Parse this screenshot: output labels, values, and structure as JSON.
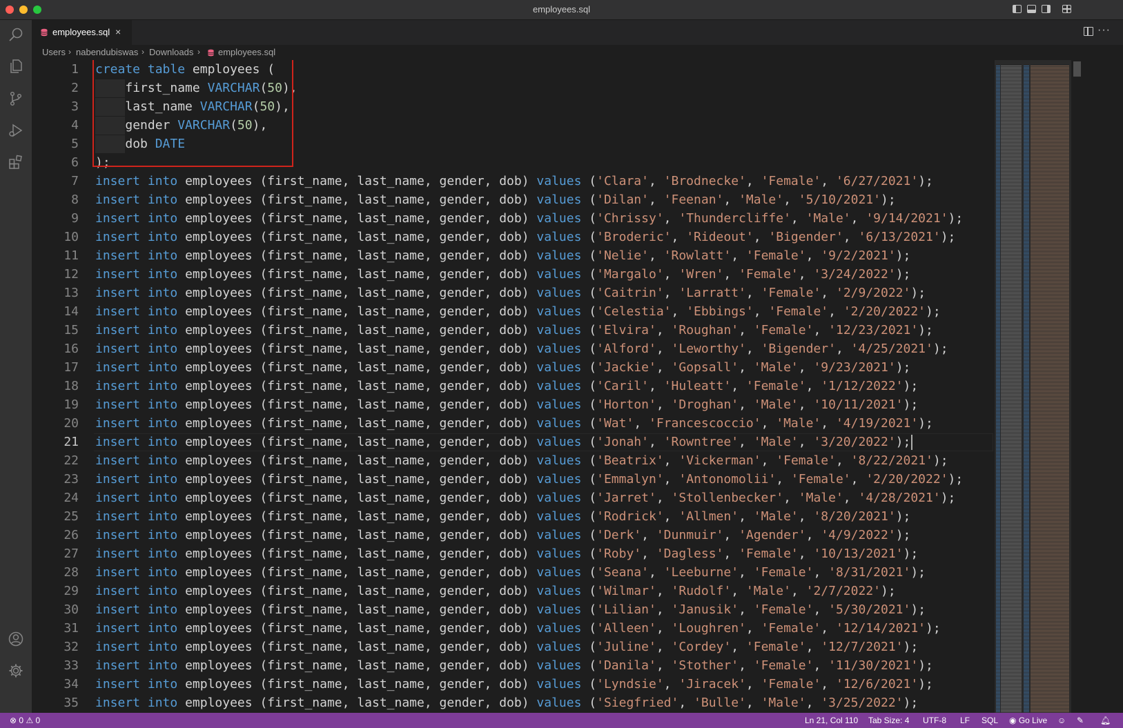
{
  "window": {
    "title": "employees.sql"
  },
  "tab": {
    "label": "employees.sql",
    "close": "×"
  },
  "breadcrumb": [
    "Users",
    "nabendubiswas",
    "Downloads",
    "employees.sql"
  ],
  "editor": {
    "active_line": 21,
    "lines": [
      [
        {
          "t": "create",
          "c": "kw"
        },
        {
          "t": " "
        },
        {
          "t": "table",
          "c": "kw"
        },
        {
          "t": " employees ("
        }
      ],
      [
        {
          "t": "    ",
          "c": "ig"
        },
        {
          "t": "first_name "
        },
        {
          "t": "VARCHAR",
          "c": "kw"
        },
        {
          "t": "("
        },
        {
          "t": "50",
          "c": "num"
        },
        {
          "t": "),"
        }
      ],
      [
        {
          "t": "    ",
          "c": "ig"
        },
        {
          "t": "last_name "
        },
        {
          "t": "VARCHAR",
          "c": "kw"
        },
        {
          "t": "("
        },
        {
          "t": "50",
          "c": "num"
        },
        {
          "t": "),"
        }
      ],
      [
        {
          "t": "    ",
          "c": "ig"
        },
        {
          "t": "gender "
        },
        {
          "t": "VARCHAR",
          "c": "kw"
        },
        {
          "t": "("
        },
        {
          "t": "50",
          "c": "num"
        },
        {
          "t": "),"
        }
      ],
      [
        {
          "t": "    ",
          "c": "ig"
        },
        {
          "t": "dob "
        },
        {
          "t": "DATE",
          "c": "kw"
        }
      ],
      [
        {
          "t": ");"
        }
      ],
      {
        "ins": [
          "Clara",
          "Brodnecke",
          "Female",
          "6/27/2021"
        ]
      },
      {
        "ins": [
          "Dilan",
          "Feenan",
          "Male",
          "5/10/2021"
        ]
      },
      {
        "ins": [
          "Chrissy",
          "Thundercliffe",
          "Male",
          "9/14/2021"
        ]
      },
      {
        "ins": [
          "Broderic",
          "Rideout",
          "Bigender",
          "6/13/2021"
        ]
      },
      {
        "ins": [
          "Nelie",
          "Rowlatt",
          "Female",
          "9/2/2021"
        ]
      },
      {
        "ins": [
          "Margalo",
          "Wren",
          "Female",
          "3/24/2022"
        ]
      },
      {
        "ins": [
          "Caitrin",
          "Larratt",
          "Female",
          "2/9/2022"
        ]
      },
      {
        "ins": [
          "Celestia",
          "Ebbings",
          "Female",
          "2/20/2022"
        ]
      },
      {
        "ins": [
          "Elvira",
          "Roughan",
          "Female",
          "12/23/2021"
        ]
      },
      {
        "ins": [
          "Alford",
          "Leworthy",
          "Bigender",
          "4/25/2021"
        ]
      },
      {
        "ins": [
          "Jackie",
          "Gopsall",
          "Male",
          "9/23/2021"
        ]
      },
      {
        "ins": [
          "Caril",
          "Huleatt",
          "Female",
          "1/12/2022"
        ]
      },
      {
        "ins": [
          "Horton",
          "Droghan",
          "Male",
          "10/11/2021"
        ]
      },
      {
        "ins": [
          "Wat",
          "Francescoccio",
          "Male",
          "4/19/2021"
        ]
      },
      {
        "ins": [
          "Jonah",
          "Rowntree",
          "Male",
          "3/20/2022"
        ]
      },
      {
        "ins": [
          "Beatrix",
          "Vickerman",
          "Female",
          "8/22/2021"
        ]
      },
      {
        "ins": [
          "Emmalyn",
          "Antonomolii",
          "Female",
          "2/20/2022"
        ]
      },
      {
        "ins": [
          "Jarret",
          "Stollenbecker",
          "Male",
          "4/28/2021"
        ]
      },
      {
        "ins": [
          "Rodrick",
          "Allmen",
          "Male",
          "8/20/2021"
        ]
      },
      {
        "ins": [
          "Derk",
          "Dunmuir",
          "Agender",
          "4/9/2022"
        ]
      },
      {
        "ins": [
          "Roby",
          "Dagless",
          "Female",
          "10/13/2021"
        ]
      },
      {
        "ins": [
          "Seana",
          "Leeburne",
          "Female",
          "8/31/2021"
        ]
      },
      {
        "ins": [
          "Wilmar",
          "Rudolf",
          "Male",
          "2/7/2022"
        ]
      },
      {
        "ins": [
          "Lilian",
          "Janusik",
          "Female",
          "5/30/2021"
        ]
      },
      {
        "ins": [
          "Alleen",
          "Loughren",
          "Female",
          "12/14/2021"
        ]
      },
      {
        "ins": [
          "Juline",
          "Cordey",
          "Female",
          "12/7/2021"
        ]
      },
      {
        "ins": [
          "Danila",
          "Stother",
          "Female",
          "11/30/2021"
        ]
      },
      {
        "ins": [
          "Lyndsie",
          "Jiracek",
          "Female",
          "12/6/2021"
        ]
      },
      {
        "ins": [
          "Siegfried",
          "Bulle",
          "Male",
          "3/25/2022"
        ]
      }
    ],
    "insert_prefix": {
      "kw1": "insert",
      "kw2": "into",
      "mid": " employees (first_name, last_name, gender, dob) ",
      "kw3": "values"
    }
  },
  "statusbar": {
    "errors": "0",
    "warnings": "0",
    "position": "Ln 21, Col 110",
    "tab_size": "Tab Size: 4",
    "encoding": "UTF-8",
    "eol": "LF",
    "language": "SQL",
    "go_live": "Go Live"
  },
  "colors": {
    "keyword": "#569cd6",
    "string": "#ce9178",
    "number": "#b5cea8",
    "statusbar": "#7d3c98",
    "highlight_box": "#d0241b"
  }
}
